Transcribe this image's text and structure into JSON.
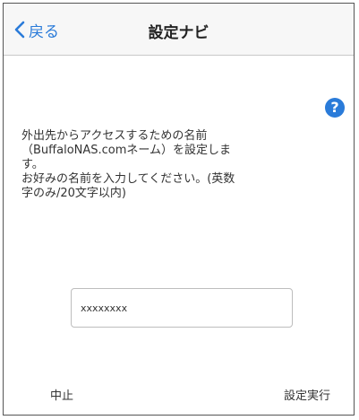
{
  "nav": {
    "back_label": "戻る",
    "title": "設定ナビ"
  },
  "help": {
    "icon_label": "?"
  },
  "description": {
    "line1": "外出先からアクセスするための名前\n（BuffaloNAS.comネーム）を設定しま\nす。",
    "line2": "お好みの名前を入力してください。(英数\n字のみ/20文字以内)"
  },
  "name_field": {
    "value": "xxxxxxxx"
  },
  "footer": {
    "cancel_label": "中止",
    "execute_label": "設定実行"
  },
  "colors": {
    "accent": "#2a7bd9",
    "navbar_bg": "#f7f7f7",
    "text": "#333333"
  }
}
